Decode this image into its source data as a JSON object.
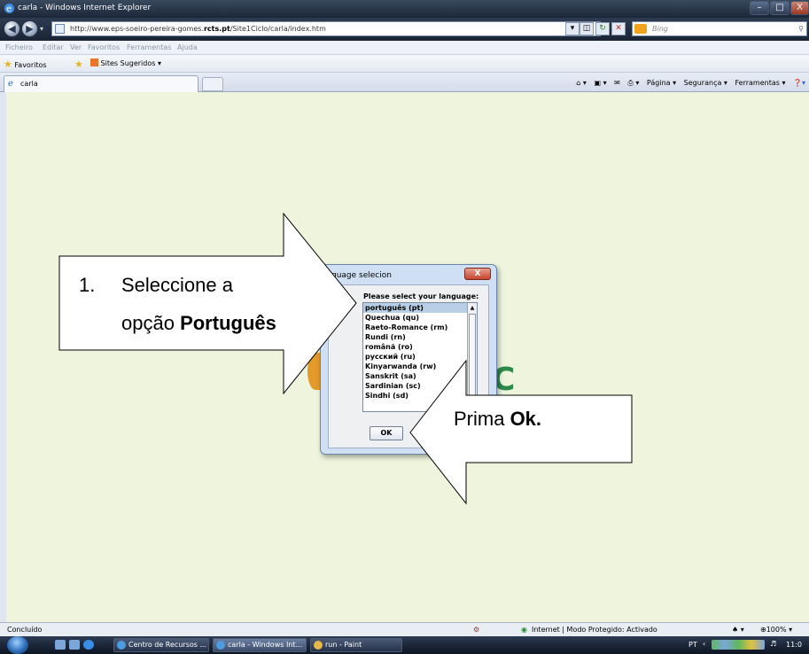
{
  "window": {
    "title": "carla - Windows Internet Explorer",
    "min": "–",
    "max": "□",
    "close": "X"
  },
  "address": {
    "prefix": "http://www.eps-soeiro-pereira-gomes.",
    "domain": "rcts.pt",
    "suffix": "/Site1Ciclo/carla/index.htm"
  },
  "search": {
    "placeholder": "Bing"
  },
  "menu": {
    "items": [
      "Ficheiro",
      "Editar",
      "Ver",
      "Favoritos",
      "Ferramentas",
      "Ajuda"
    ]
  },
  "favorites": {
    "label": "Favoritos",
    "suggested": "Sites Sugeridos ▾"
  },
  "tab": {
    "title": "carla"
  },
  "commandbar": {
    "pagina": "Página ▾",
    "seguranca": "Segurança ▾",
    "ferramentas": "Ferramentas ▾"
  },
  "dialog": {
    "title": "guage selecion",
    "close": "X",
    "prompt": "Please select your language:",
    "languages": [
      "português (pt)",
      "Quechua (qu)",
      "Raeto-Romance (rm)",
      "Rundi (rn)",
      "română (ro)",
      "русский (ru)",
      "Kinyarwanda (rw)",
      "Sanskrit (sa)",
      "Sardinian (sc)",
      "Sindhi (sd)"
    ],
    "selected_index": 0,
    "ok": "OK"
  },
  "callouts": {
    "step1_number": "1.",
    "step1_line1": "Seleccione a",
    "step1_line2_prefix": "opção ",
    "step1_line2_bold": "Português",
    "step2_prefix": "Prima ",
    "step2_bold": "Ok."
  },
  "status": {
    "left": "Concluído",
    "zone": "Internet | Modo Protegido: Activado",
    "zoom": "⊕100% ▾"
  },
  "taskbar": {
    "tasks": [
      "Centro de Recursos ...",
      "carla - Windows Int...",
      "run - Paint"
    ],
    "lang": "PT",
    "clock": "11:0"
  },
  "colors": {
    "content_bg": "#eef5dc",
    "titlebar": "#1b2638",
    "selection": "#b8cfe5"
  }
}
